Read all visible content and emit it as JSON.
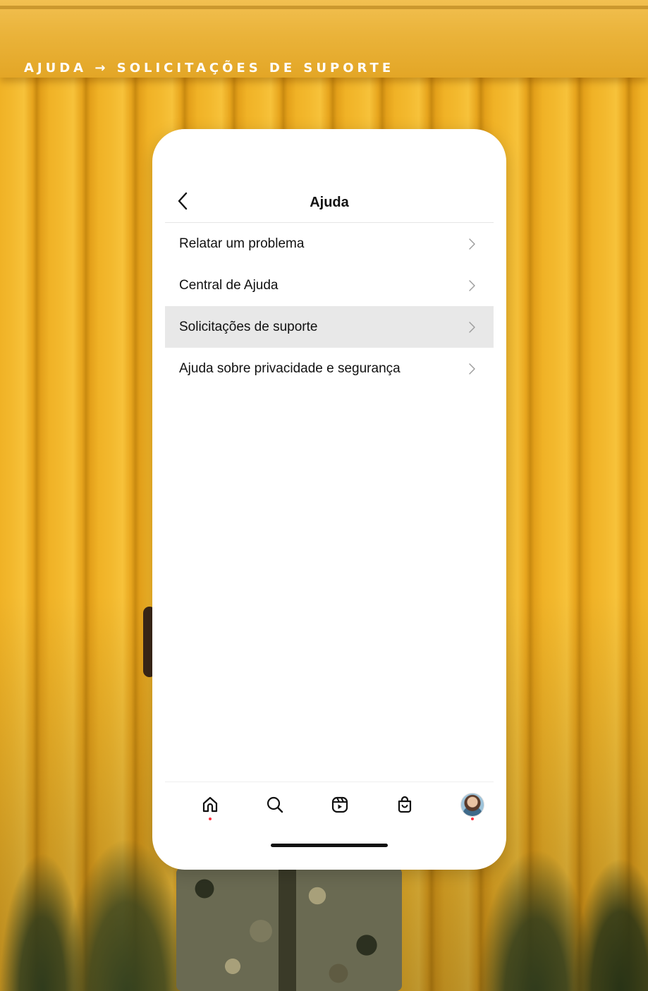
{
  "breadcrumb": "AJUDA → SOLICITAÇÕES DE SUPORTE",
  "header": {
    "title": "Ajuda",
    "back_icon": "chevron-left-icon"
  },
  "menu": {
    "items": [
      {
        "label": "Relatar um problema",
        "selected": false
      },
      {
        "label": "Central de Ajuda",
        "selected": false
      },
      {
        "label": "Solicitações de suporte",
        "selected": true
      },
      {
        "label": "Ajuda sobre privacidade e segurança",
        "selected": false
      }
    ],
    "chevron_icon": "chevron-right-icon"
  },
  "tabbar": {
    "tabs": [
      {
        "icon": "home-icon",
        "notification_dot": true
      },
      {
        "icon": "search-icon",
        "notification_dot": false
      },
      {
        "icon": "reels-icon",
        "notification_dot": false
      },
      {
        "icon": "shop-icon",
        "notification_dot": false
      },
      {
        "icon": "profile-avatar",
        "notification_dot": true
      }
    ]
  },
  "colors": {
    "accent_dot": "#ff3040",
    "selected_row": "#e8e8e8",
    "background_wall": "#f0b226"
  }
}
